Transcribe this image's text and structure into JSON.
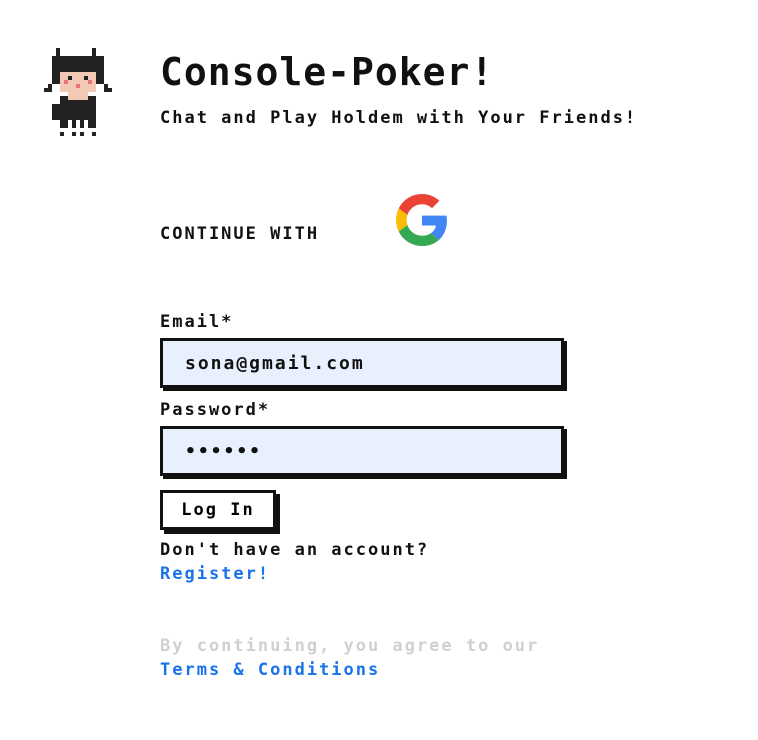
{
  "header": {
    "title": "Console-Poker!",
    "subtitle": "Chat and Play Holdem with Your Friends!"
  },
  "oauth": {
    "continue_label": "CONTINUE WITH",
    "provider_icon": "google-icon"
  },
  "form": {
    "email_label": "Email*",
    "email_value": "sona@gmail.com",
    "password_label": "Password*",
    "password_value": "••••••",
    "login_label": "Log In"
  },
  "register": {
    "prompt": "Don't have an account?",
    "link_label": "Register!"
  },
  "legal": {
    "agree_text": "By continuing, you agree to our",
    "terms_label": "Terms & Conditions"
  },
  "colors": {
    "link": "#1a73e8",
    "field_bg": "#e8f0fe",
    "muted": "#d0d0d0"
  }
}
